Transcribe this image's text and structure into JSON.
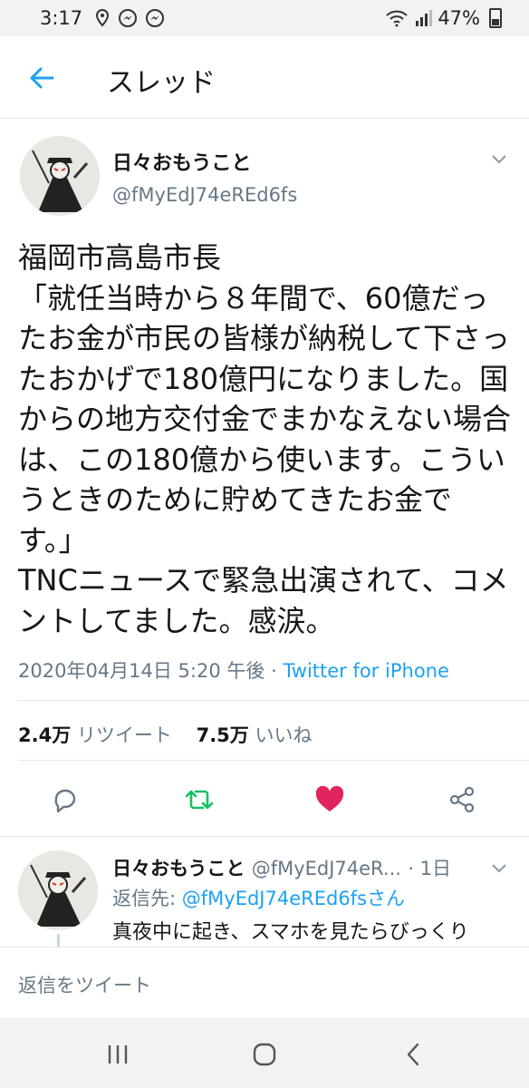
{
  "status_bar": {
    "time": "3:17",
    "battery": "47%"
  },
  "header": {
    "title": "スレッド"
  },
  "tweet": {
    "author_name": "日々おもうこと",
    "author_handle": "@fMyEdJ74eREd6fs",
    "text": "福岡市高島市長\n「就任当時から８年間で、60億だったお金が市民の皆様が納税して下さったおかげで180億円になりました。国からの地方交付金でまかなえない場合は、この180億から使います。こういうときのために貯めてきたお金です。」\nTNCニュースで緊急出演されて、コメントしてました。感涙。",
    "timestamp": "2020年04月14日 5:20 午後",
    "separator": " · ",
    "source": "Twitter for iPhone",
    "retweet_count": "2.4万",
    "retweet_label": "リツイート",
    "like_count": "7.5万",
    "like_label": "いいね"
  },
  "reply": {
    "author_name": "日々おもうこと",
    "author_handle": "@fMyEdJ74eR...",
    "time": "· 1日",
    "reply_prefix": "返信先: ",
    "reply_to": "@fMyEdJ74eREd6fsさん",
    "body": "真夜中に起き、スマホを見たらびっくり"
  },
  "compose": {
    "placeholder": "返信をツイート"
  },
  "colors": {
    "accent": "#1da1f2",
    "retweet": "#17bf63",
    "like": "#e0245e",
    "secondary_text": "#657786"
  },
  "icons": [
    "back-arrow-icon",
    "chevron-down-icon",
    "reply-icon",
    "retweet-icon",
    "heart-icon",
    "share-icon",
    "recent-apps-icon",
    "home-icon",
    "back-icon"
  ]
}
